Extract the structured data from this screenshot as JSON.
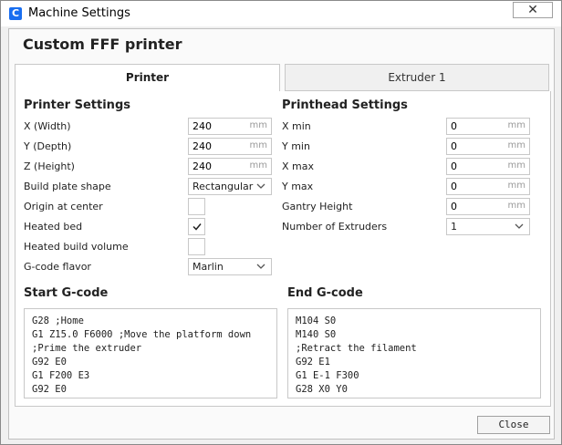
{
  "window": {
    "title": "Machine Settings",
    "close_glyph": "✕"
  },
  "heading": "Custom FFF printer",
  "tabs": [
    {
      "label": "Printer",
      "active": true
    },
    {
      "label": "Extruder 1",
      "active": false
    }
  ],
  "printer_settings": {
    "title": "Printer Settings",
    "x_width": {
      "label": "X (Width)",
      "value": "240",
      "unit": "mm"
    },
    "y_depth": {
      "label": "Y (Depth)",
      "value": "240",
      "unit": "mm"
    },
    "z_height": {
      "label": "Z (Height)",
      "value": "240",
      "unit": "mm"
    },
    "build_plate_shape": {
      "label": "Build plate shape",
      "value": "Rectangular"
    },
    "origin_at_center": {
      "label": "Origin at center",
      "checked": false
    },
    "heated_bed": {
      "label": "Heated bed",
      "checked": true
    },
    "heated_build_volume": {
      "label": "Heated build volume",
      "checked": false
    },
    "gcode_flavor": {
      "label": "G-code flavor",
      "value": "Marlin"
    }
  },
  "printhead_settings": {
    "title": "Printhead Settings",
    "x_min": {
      "label": "X min",
      "value": "0",
      "unit": "mm"
    },
    "y_min": {
      "label": "Y min",
      "value": "0",
      "unit": "mm"
    },
    "x_max": {
      "label": "X max",
      "value": "0",
      "unit": "mm"
    },
    "y_max": {
      "label": "Y max",
      "value": "0",
      "unit": "mm"
    },
    "gantry_height": {
      "label": "Gantry Height",
      "value": "0",
      "unit": "mm"
    },
    "number_of_extruders": {
      "label": "Number of Extruders",
      "value": "1"
    }
  },
  "start_gcode": {
    "title": "Start G-code",
    "text": "G28 ;Home\nG1 Z15.0 F6000 ;Move the platform down\n;Prime the extruder\nG92 E0\nG1 F200 E3\nG92 E0"
  },
  "end_gcode": {
    "title": "End G-code",
    "text": "M104 S0\nM140 S0\n;Retract the filament\nG92 E1\nG1 E-1 F300\nG28 X0 Y0"
  },
  "buttons": {
    "close": "Close"
  },
  "colors": {
    "accent": "#196ef0"
  },
  "icons": {
    "app": "cura-app-icon",
    "check": "checkmark-icon",
    "chevron": "chevron-down-icon"
  }
}
